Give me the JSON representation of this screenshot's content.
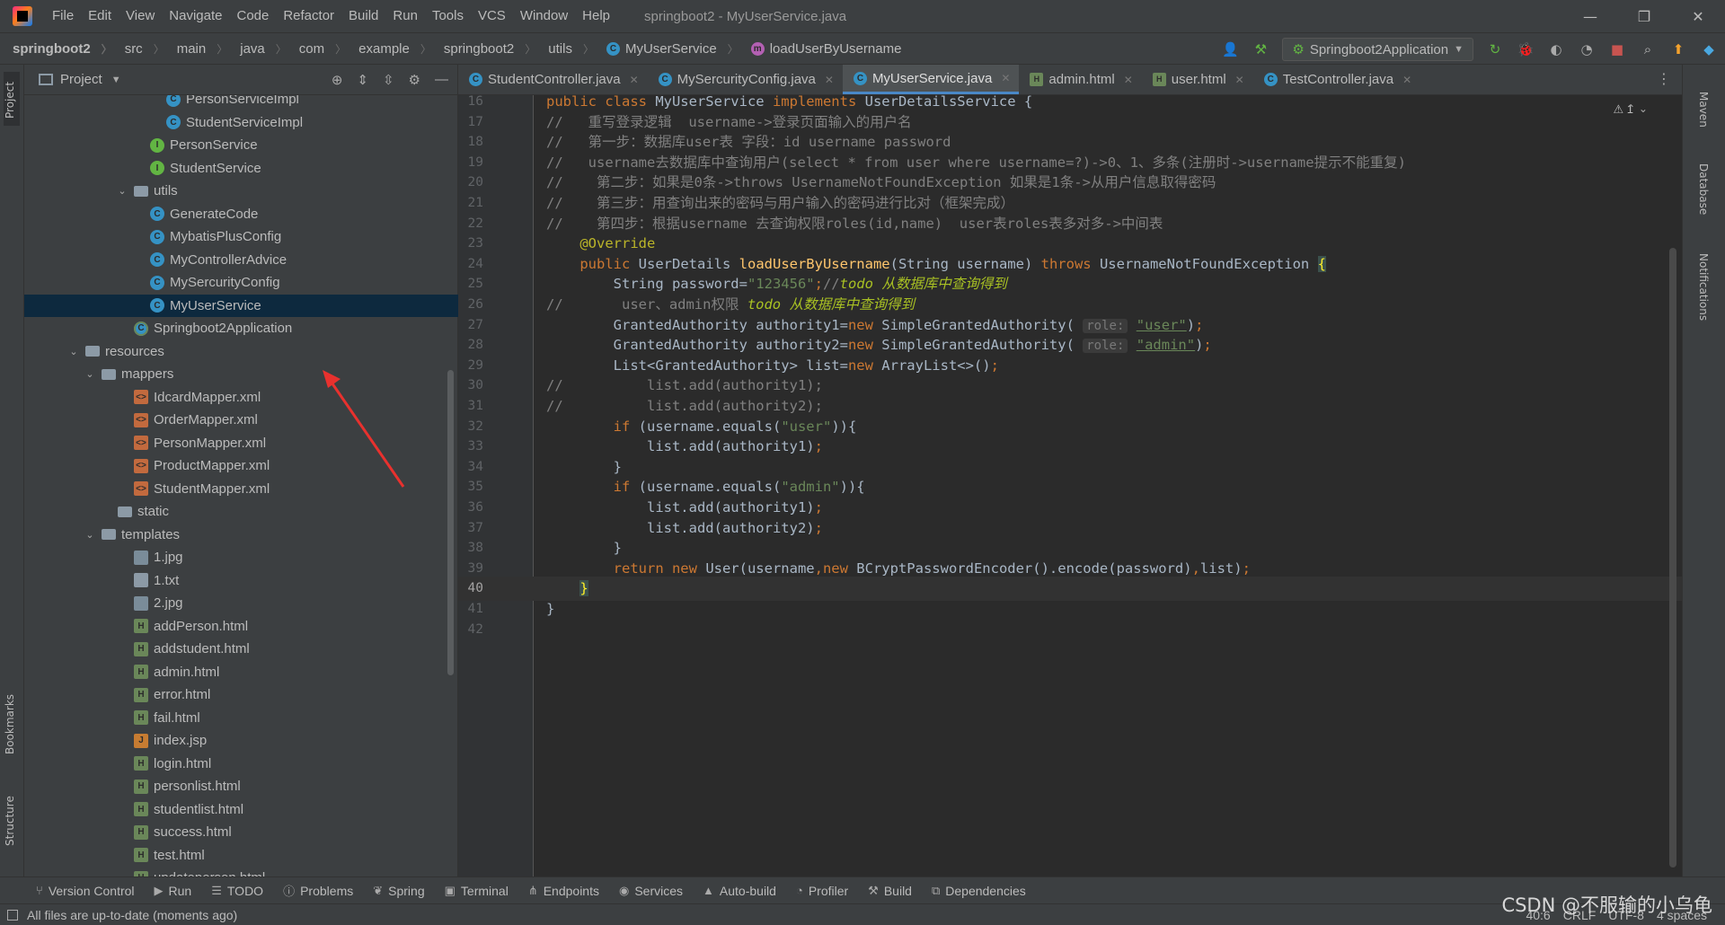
{
  "window": {
    "title": "springboot2 - MyUserService.java",
    "minimize": "—",
    "restore": "❐",
    "close": "✕"
  },
  "menu": [
    "File",
    "Edit",
    "View",
    "Navigate",
    "Code",
    "Refactor",
    "Build",
    "Run",
    "Tools",
    "VCS",
    "Window",
    "Help"
  ],
  "breadcrumb": [
    "springboot2",
    "src",
    "main",
    "java",
    "com",
    "example",
    "springboot2",
    "utils",
    "MyUserService",
    "loadUserByUsername"
  ],
  "run_config": "Springboot2Application",
  "project_panel": {
    "title": "Project",
    "tree": [
      {
        "label": "PersonServiceImpl",
        "icon": "class",
        "depth": 9
      },
      {
        "label": "StudentServiceImpl",
        "icon": "class",
        "depth": 9
      },
      {
        "label": "PersonService",
        "icon": "interface",
        "depth": 8
      },
      {
        "label": "StudentService",
        "icon": "interface",
        "depth": 8
      },
      {
        "label": "utils",
        "icon": "folder",
        "depth": 7,
        "arrow": "v"
      },
      {
        "label": "GenerateCode",
        "icon": "class",
        "depth": 8
      },
      {
        "label": "MybatisPlusConfig",
        "icon": "class",
        "depth": 8
      },
      {
        "label": "MyControllerAdvice",
        "icon": "class",
        "depth": 8
      },
      {
        "label": "MySercurityConfig",
        "icon": "class",
        "depth": 8
      },
      {
        "label": "MyUserService",
        "icon": "class",
        "depth": 8,
        "selected": true
      },
      {
        "label": "Springboot2Application",
        "icon": "spring",
        "depth": 7
      },
      {
        "label": "resources",
        "icon": "folder",
        "depth": 4,
        "arrow": "v"
      },
      {
        "label": "mappers",
        "icon": "folder",
        "depth": 5,
        "arrow": "v"
      },
      {
        "label": "IdcardMapper.xml",
        "icon": "xml",
        "depth": 7
      },
      {
        "label": "OrderMapper.xml",
        "icon": "xml",
        "depth": 7
      },
      {
        "label": "PersonMapper.xml",
        "icon": "xml",
        "depth": 7
      },
      {
        "label": "ProductMapper.xml",
        "icon": "xml",
        "depth": 7
      },
      {
        "label": "StudentMapper.xml",
        "icon": "xml",
        "depth": 7
      },
      {
        "label": "static",
        "icon": "folder",
        "depth": 6
      },
      {
        "label": "templates",
        "icon": "folder",
        "depth": 5,
        "arrow": "v"
      },
      {
        "label": "1.jpg",
        "icon": "image",
        "depth": 7
      },
      {
        "label": "1.txt",
        "icon": "text",
        "depth": 7
      },
      {
        "label": "2.jpg",
        "icon": "image",
        "depth": 7
      },
      {
        "label": "addPerson.html",
        "icon": "html",
        "depth": 7
      },
      {
        "label": "addstudent.html",
        "icon": "html",
        "depth": 7
      },
      {
        "label": "admin.html",
        "icon": "html",
        "depth": 7
      },
      {
        "label": "error.html",
        "icon": "html",
        "depth": 7
      },
      {
        "label": "fail.html",
        "icon": "html",
        "depth": 7
      },
      {
        "label": "index.jsp",
        "icon": "jsp",
        "depth": 7
      },
      {
        "label": "login.html",
        "icon": "html",
        "depth": 7
      },
      {
        "label": "personlist.html",
        "icon": "html",
        "depth": 7
      },
      {
        "label": "studentlist.html",
        "icon": "html",
        "depth": 7
      },
      {
        "label": "success.html",
        "icon": "html",
        "depth": 7
      },
      {
        "label": "test.html",
        "icon": "html",
        "depth": 7
      },
      {
        "label": "updateperson.html",
        "icon": "html",
        "depth": 7
      }
    ]
  },
  "editor_tabs": [
    {
      "label": "StudentController.java",
      "icon": "class",
      "active": false
    },
    {
      "label": "MySercurityConfig.java",
      "icon": "class",
      "active": false
    },
    {
      "label": "MyUserService.java",
      "icon": "class",
      "active": true
    },
    {
      "label": "admin.html",
      "icon": "html",
      "active": false
    },
    {
      "label": "user.html",
      "icon": "html",
      "active": false
    },
    {
      "label": "TestController.java",
      "icon": "class",
      "active": false
    }
  ],
  "warnings_indicator": "⚠ 1",
  "code_lines": [
    {
      "n": "16",
      "html": "<span class='kw'>public class</span> MyUserService <span class='kw'>implements</span> UserDetailsService {"
    },
    {
      "n": "17",
      "html": "<span class='cm'>//   重写登录逻辑  username-&gt;登录页面输入的用户名</span>"
    },
    {
      "n": "18",
      "html": "<span class='cm'>//   第一步：数据库user表 字段：id username password</span>"
    },
    {
      "n": "19",
      "html": "<span class='cm'>//   username去数据库中查询用户(select * from user where username=?)-&gt;0、1、多条(注册时-&gt;username提示不能重复)</span>"
    },
    {
      "n": "20",
      "html": "<span class='cm'>//    第二步：如果是0条-&gt;throws UsernameNotFoundException 如果是1条-&gt;从用户信息取得密码</span>"
    },
    {
      "n": "21",
      "html": "<span class='cm'>//    第三步：用查询出来的密码与用户输入的密码进行比对（框架完成）</span>"
    },
    {
      "n": "22",
      "html": "<span class='cm'>//    第四步：根据username 去查询权限roles(id,name)  user表roles表多对多-&gt;中间表</span>"
    },
    {
      "n": "23",
      "html": "    <span class='ann'>@Override</span>"
    },
    {
      "n": "24",
      "html": "    <span class='kw'>public</span> UserDetails <span class='mth'>loadUserByUsername</span>(String username) <span class='kw'>throws</span> UsernameNotFoundException <span class='brace-hl'>{</span>"
    },
    {
      "n": "25",
      "html": "        String password=<span class='str'>\"123456\"</span><span class='kw'>;</span><span class='cm'>//</span><span class='todo'>todo 从数据库中查询得到</span>"
    },
    {
      "n": "26",
      "html": "<span class='cm'>//       user、admin权限 </span><span class='todo'>todo 从数据库中查询得到</span>"
    },
    {
      "n": "27",
      "html": "        GrantedAuthority authority1=<span class='kw'>new</span> SimpleGrantedAuthority( <span class='hint'>role:</span> <span class='str ul'>\"user\"</span>)<span class='kw'>;</span>"
    },
    {
      "n": "28",
      "html": "        GrantedAuthority authority2=<span class='kw'>new</span> SimpleGrantedAuthority( <span class='hint'>role:</span> <span class='str ul'>\"admin\"</span>)<span class='kw'>;</span>"
    },
    {
      "n": "29",
      "html": "        List&lt;GrantedAuthority&gt; list=<span class='kw'>new</span> ArrayList&lt;&gt;()<span class='kw'>;</span>"
    },
    {
      "n": "30",
      "html": "<span class='cm'>//          list.add(authority1);</span>"
    },
    {
      "n": "31",
      "html": "<span class='cm'>//          list.add(authority2);</span>"
    },
    {
      "n": "32",
      "html": "        <span class='kw'>if</span> (username.equals(<span class='str'>\"user\"</span>)){"
    },
    {
      "n": "33",
      "html": "            list.add(authority1)<span class='kw'>;</span>"
    },
    {
      "n": "34",
      "html": "        }"
    },
    {
      "n": "35",
      "html": "        <span class='kw'>if</span> (username.equals(<span class='str'>\"admin\"</span>)){"
    },
    {
      "n": "36",
      "html": "            list.add(authority1)<span class='kw'>;</span>"
    },
    {
      "n": "37",
      "html": "            list.add(authority2)<span class='kw'>;</span>"
    },
    {
      "n": "38",
      "html": "        }"
    },
    {
      "n": "39",
      "html": "        <span class='kw'>return new</span> User(username<span class='kw'>,new</span> BCryptPasswordEncoder().encode(password)<span class='kw'>,</span>list)<span class='kw'>;</span>"
    },
    {
      "n": "40",
      "html": "    <span class='brace-hl'>}</span>",
      "current": true
    },
    {
      "n": "41",
      "html": "}"
    },
    {
      "n": "42",
      "html": ""
    }
  ],
  "left_stripe": {
    "project": "Project",
    "bookmarks": "Bookmarks",
    "structure": "Structure"
  },
  "right_stripe": {
    "maven": "Maven",
    "database": "Database",
    "notifications": "Notifications"
  },
  "bottom_tools": [
    {
      "label": "Version Control",
      "icon": "branch-icon"
    },
    {
      "label": "Run",
      "icon": "play-icon"
    },
    {
      "label": "TODO",
      "icon": "list-icon"
    },
    {
      "label": "Problems",
      "icon": "problems-icon"
    },
    {
      "label": "Spring",
      "icon": "spring-icon"
    },
    {
      "label": "Terminal",
      "icon": "terminal-icon"
    },
    {
      "label": "Endpoints",
      "icon": "endpoints-icon"
    },
    {
      "label": "Services",
      "icon": "services-icon"
    },
    {
      "label": "Auto-build",
      "icon": "warning-icon"
    },
    {
      "label": "Profiler",
      "icon": "profiler-icon"
    },
    {
      "label": "Build",
      "icon": "hammer-icon"
    },
    {
      "label": "Dependencies",
      "icon": "dependencies-icon"
    }
  ],
  "status": {
    "message": "All files are up-to-date (moments ago)",
    "position": "40:6",
    "line_ending": "CRLF",
    "encoding": "UTF-8",
    "indent": "4 spaces"
  },
  "watermark": "CSDN @不服输的小乌龟"
}
